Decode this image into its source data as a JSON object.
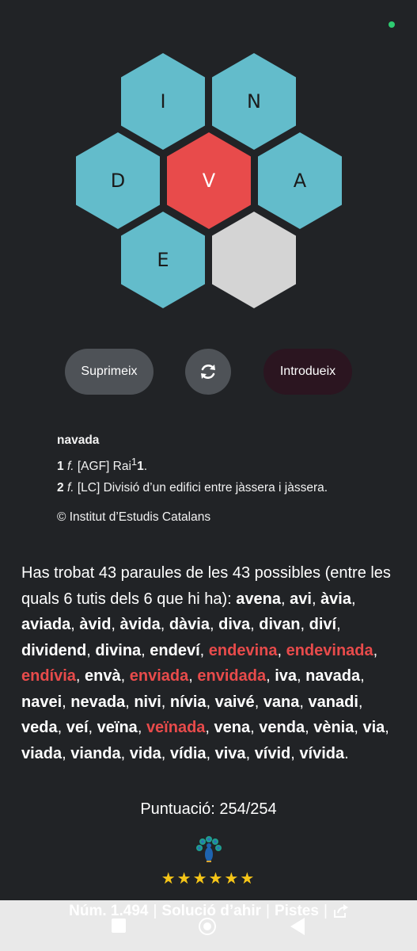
{
  "colors": {
    "outer_hex": "#63bccb",
    "center_hex": "#e84b4b",
    "empty_hex": "#d4d4d4",
    "tuti_word": "#e84b4b",
    "stars": "#f5c518"
  },
  "hive": {
    "top_left": "I",
    "top_right": "N",
    "mid_left": "D",
    "center": "V",
    "mid_right": "A",
    "bottom_left": "E"
  },
  "buttons": {
    "delete_label": "Suprimeix",
    "shuffle_icon": "shuffle-icon",
    "enter_label": "Introdueix"
  },
  "definition": {
    "word": "navada",
    "sense1_num": "1",
    "sense1_cat": "f.",
    "sense1_text": "[AGF] Rai",
    "sense1_sup": "1",
    "sense1_ref": "1",
    "sense1_end": ".",
    "sense2_num": "2",
    "sense2_cat": "f.",
    "sense2_text": "[LC] Divisió d’un edifici entre jàssera i jàssera.",
    "copyright": "© Institut d’Estudis Catalans"
  },
  "results": {
    "intro": "Has trobat 43 paraules de les 43 possibles (entre les quals 6 tutis dels 6 que hi ha): ",
    "words": [
      {
        "w": "avena",
        "tuti": false
      },
      {
        "w": "avi",
        "tuti": false
      },
      {
        "w": "àvia",
        "tuti": false
      },
      {
        "w": "aviada",
        "tuti": false
      },
      {
        "w": "àvid",
        "tuti": false
      },
      {
        "w": "àvida",
        "tuti": false
      },
      {
        "w": "dàvia",
        "tuti": false
      },
      {
        "w": "diva",
        "tuti": false
      },
      {
        "w": "divan",
        "tuti": false
      },
      {
        "w": "diví",
        "tuti": false
      },
      {
        "w": "dividend",
        "tuti": false
      },
      {
        "w": "divina",
        "tuti": false
      },
      {
        "w": "endeví",
        "tuti": false
      },
      {
        "w": "endevina",
        "tuti": true
      },
      {
        "w": "endevinada",
        "tuti": true
      },
      {
        "w": "endívia",
        "tuti": true
      },
      {
        "w": "envà",
        "tuti": false
      },
      {
        "w": "enviada",
        "tuti": true
      },
      {
        "w": "envidada",
        "tuti": true
      },
      {
        "w": "iva",
        "tuti": false
      },
      {
        "w": "navada",
        "tuti": false
      },
      {
        "w": "navei",
        "tuti": false
      },
      {
        "w": "nevada",
        "tuti": false
      },
      {
        "w": "nivi",
        "tuti": false
      },
      {
        "w": "nívia",
        "tuti": false
      },
      {
        "w": "vaivé",
        "tuti": false
      },
      {
        "w": "vana",
        "tuti": false
      },
      {
        "w": "vanadi",
        "tuti": false
      },
      {
        "w": "veda",
        "tuti": false
      },
      {
        "w": "veí",
        "tuti": false
      },
      {
        "w": "veïna",
        "tuti": false
      },
      {
        "w": "veïnada",
        "tuti": true
      },
      {
        "w": "vena",
        "tuti": false
      },
      {
        "w": "venda",
        "tuti": false
      },
      {
        "w": "vènia",
        "tuti": false
      },
      {
        "w": "via",
        "tuti": false
      },
      {
        "w": "viada",
        "tuti": false
      },
      {
        "w": "vianda",
        "tuti": false
      },
      {
        "w": "vida",
        "tuti": false
      },
      {
        "w": "vídia",
        "tuti": false
      },
      {
        "w": "viva",
        "tuti": false
      },
      {
        "w": "vívid",
        "tuti": false
      },
      {
        "w": "vívida",
        "tuti": false
      }
    ],
    "end": "."
  },
  "score": {
    "text": "Puntuació: 254/254"
  },
  "rating": {
    "icon": "peacock-icon",
    "stars": "★★★★★★",
    "count": 6,
    "max": 6
  },
  "footer": {
    "number": "Núm. 1.494",
    "sep": "|",
    "yesterday": "Solució d’ahir",
    "hints": "Pistes",
    "share_icon": "share-icon"
  }
}
